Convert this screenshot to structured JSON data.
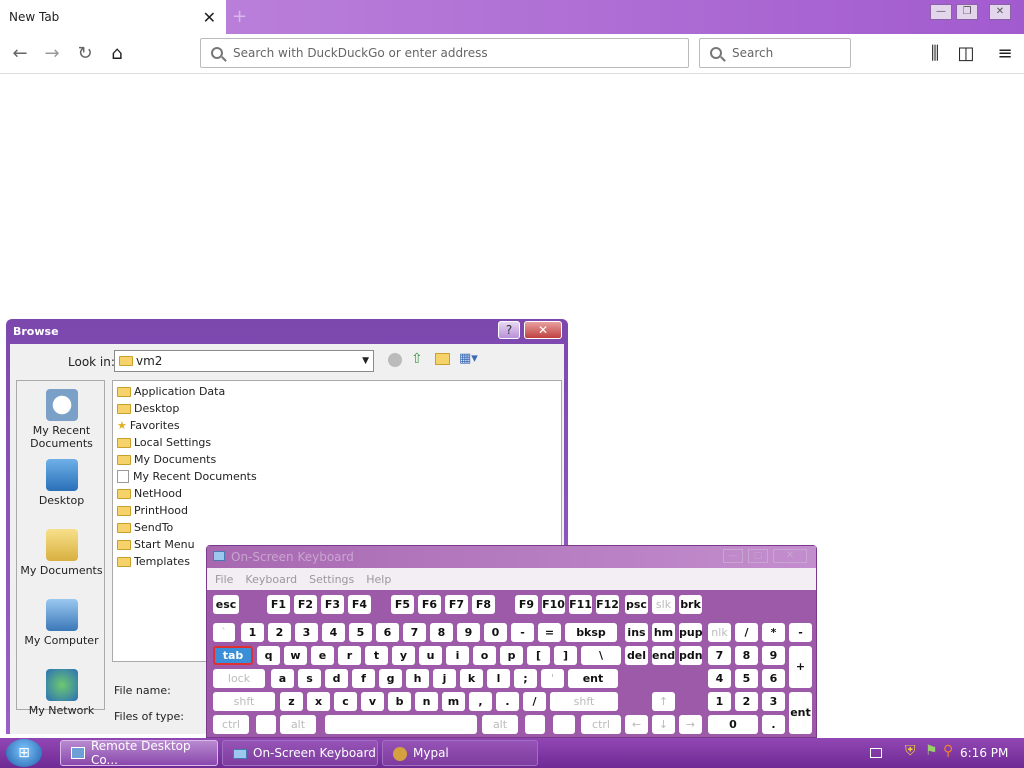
{
  "browser": {
    "tab_title": "New Tab",
    "tab_close": "✕",
    "new_tab": "+",
    "url_placeholder": "Search with DuckDuckGo or enter address",
    "search_placeholder": "Search"
  },
  "browse_dialog": {
    "title": "Browse",
    "look_in_label": "Look in:",
    "look_in_value": "vm2",
    "places": [
      {
        "label": "My Recent Documents"
      },
      {
        "label": "Desktop"
      },
      {
        "label": "My Documents"
      },
      {
        "label": "My Computer"
      },
      {
        "label": "My Network"
      }
    ],
    "files": [
      {
        "name": "Application Data",
        "icon": "folder-icon"
      },
      {
        "name": "Desktop",
        "icon": "folder-icon"
      },
      {
        "name": "Favorites",
        "icon": "star-icon"
      },
      {
        "name": "Local Settings",
        "icon": "folder-icon"
      },
      {
        "name": "My Documents",
        "icon": "folder-icon"
      },
      {
        "name": "My Recent Documents",
        "icon": "document-icon"
      },
      {
        "name": "NetHood",
        "icon": "folder-icon"
      },
      {
        "name": "PrintHood",
        "icon": "folder-icon"
      },
      {
        "name": "SendTo",
        "icon": "folder-icon"
      },
      {
        "name": "Start Menu",
        "icon": "folder-icon"
      },
      {
        "name": "Templates",
        "icon": "folder-icon"
      }
    ],
    "file_name_label": "File name:",
    "files_of_type_label": "Files of type:"
  },
  "osk": {
    "title": "On-Screen Keyboard",
    "menu": [
      "File",
      "Keyboard",
      "Settings",
      "Help"
    ],
    "rows": {
      "fn": [
        "esc",
        "F1",
        "F2",
        "F3",
        "F4",
        "F5",
        "F6",
        "F7",
        "F8",
        "F9",
        "F10",
        "F11",
        "F12",
        "psc",
        "slk",
        "brk"
      ],
      "num": [
        "`",
        "1",
        "2",
        "3",
        "4",
        "5",
        "6",
        "7",
        "8",
        "9",
        "0",
        "-",
        "=",
        "bksp",
        "ins",
        "hm",
        "pup",
        "nlk",
        "/",
        "*",
        "-"
      ],
      "top": [
        "tab",
        "q",
        "w",
        "e",
        "r",
        "t",
        "y",
        "u",
        "i",
        "o",
        "p",
        "[",
        "]",
        "\\",
        "del",
        "end",
        "pdn",
        "7",
        "8",
        "9",
        "+"
      ],
      "home": [
        "lock",
        "a",
        "s",
        "d",
        "f",
        "g",
        "h",
        "j",
        "k",
        "l",
        ";",
        "'",
        "ent",
        "4",
        "5",
        "6"
      ],
      "bottom": [
        "shft",
        "z",
        "x",
        "c",
        "v",
        "b",
        "n",
        "m",
        ",",
        ".",
        "/",
        "shft",
        "↑",
        "1",
        "2",
        "3",
        "ent"
      ],
      "space": [
        "ctrl",
        "alt",
        "alt",
        "ctrl",
        "←",
        "↓",
        "→",
        "0",
        "."
      ]
    }
  },
  "taskbar": {
    "items": [
      "Remote Desktop Co...",
      "On-Screen Keyboard",
      "Mypal"
    ],
    "clock": "6:16 PM"
  }
}
